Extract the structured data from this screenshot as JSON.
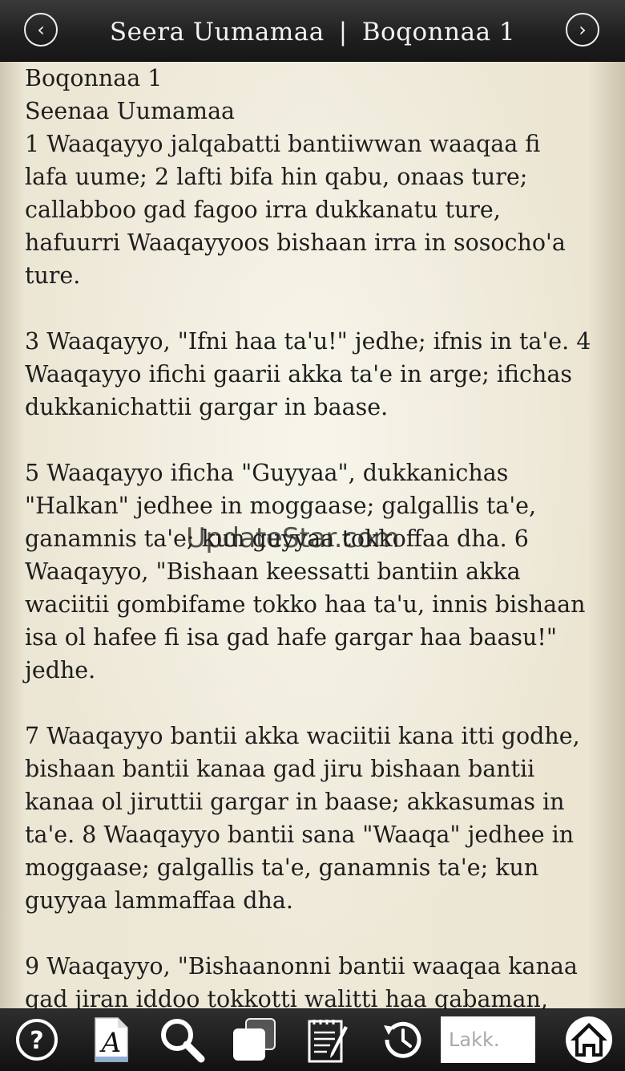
{
  "header": {
    "book": "Seera Uumamaa",
    "separator": "|",
    "chapter": "Boqonnaa 1",
    "prev_icon": "chevron-left-circle-icon",
    "next_icon": "chevron-right-circle-icon"
  },
  "content": {
    "heading": "Boqonnaa 1",
    "subheading": "Seenaa Uumamaa",
    "paragraphs": [
      [
        "1 Waaqayyo jalqabatti bantiiwwan waaqaa fi",
        "lafa uume; 2 lafti bifa hin qabu, onaas ture;",
        "callabboo gad fagoo irra dukkanatu ture,",
        "hafuurri Waaqayyoos bishaan irra in sosocho'a",
        "ture."
      ],
      [
        "3 Waaqayyo, \"Ifni haa ta'u!\" jedhe; ifnis in ta'e. 4",
        "Waaqayyo ifichi gaarii akka ta'e in arge; ifichas",
        "dukkanichattii gargar in baase."
      ],
      [
        "5 Waaqayyo ificha \"Guyyaa\", dukkanichas",
        "\"Halkan\" jedhee in moggaase; galgallis ta'e,",
        "ganamnis ta'e; kun guyyaa tokkoffaa dha. 6",
        "Waaqayyo, \"Bishaan keessatti bantiin akka",
        "waciitii gombifame tokko haa ta'u, innis bishaan",
        "isa ol hafee fi isa gad hafe gargar haa baasu!\"",
        "jedhe."
      ],
      [
        "7 Waaqayyo bantii akka waciitii kana itti godhe,",
        "bishaan bantii kanaa gad jiru bishaan bantii",
        "kanaa ol jiruttii gargar in baase; akkasumas in",
        "ta'e. 8 Waaqayyo bantii sana \"Waaqa\" jedhee in",
        "moggaase; galgallis ta'e, ganamnis ta'e; kun",
        "guyyaa lammaffaa dha."
      ],
      [
        "9 Waaqayyo, \"Bishaanonni bantii waaqaa kanaa",
        "gad jiran iddoo tokkotti walitti haa qabaman,"
      ]
    ]
  },
  "watermark": "UpdateStar.com",
  "toolbar": {
    "icons": [
      "help-icon",
      "font-icon",
      "search-icon",
      "copy-icon",
      "notes-icon",
      "history-icon",
      "home-icon"
    ],
    "lakk_placeholder": "Lakk."
  }
}
